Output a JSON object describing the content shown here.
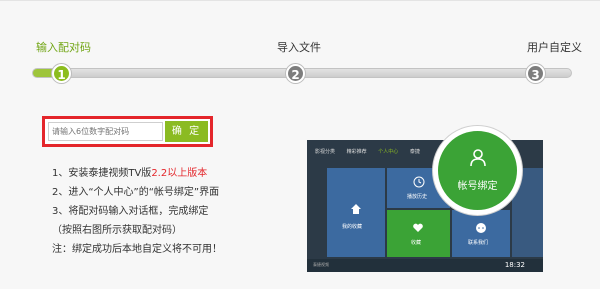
{
  "steps": [
    {
      "number": "1",
      "label": "输入配对码"
    },
    {
      "number": "2",
      "label": "导入文件"
    },
    {
      "number": "3",
      "label": "用户自定义"
    }
  ],
  "form": {
    "placeholder": "请输入6位数字配对码",
    "confirm_label": "确 定"
  },
  "instructions": {
    "line1_prefix": "1、安装泰捷视频TV版",
    "line1_highlight": "2.2以上版本",
    "line2": "2、进入“个人中心”的“帐号绑定”界面",
    "line3": "3、将配对码输入对话框，完成绑定",
    "line4": "（按照右图所示获取配对码）",
    "note": "注：绑定成功后本地自定义将不可用！"
  },
  "tv": {
    "nav": [
      "影视分类",
      "精彩推荐",
      "个人中心",
      "泰捷"
    ],
    "tiles": [
      "我的收藏",
      "播放历史",
      "收藏",
      "联系我们"
    ],
    "time": "18:32",
    "brand": "泰捷视频"
  },
  "circle": {
    "label": "帐号绑定",
    "icon": "user-icon"
  },
  "colors": {
    "accent": "#8bbb22",
    "highlight": "#e4262b",
    "circle": "#3ba336"
  }
}
